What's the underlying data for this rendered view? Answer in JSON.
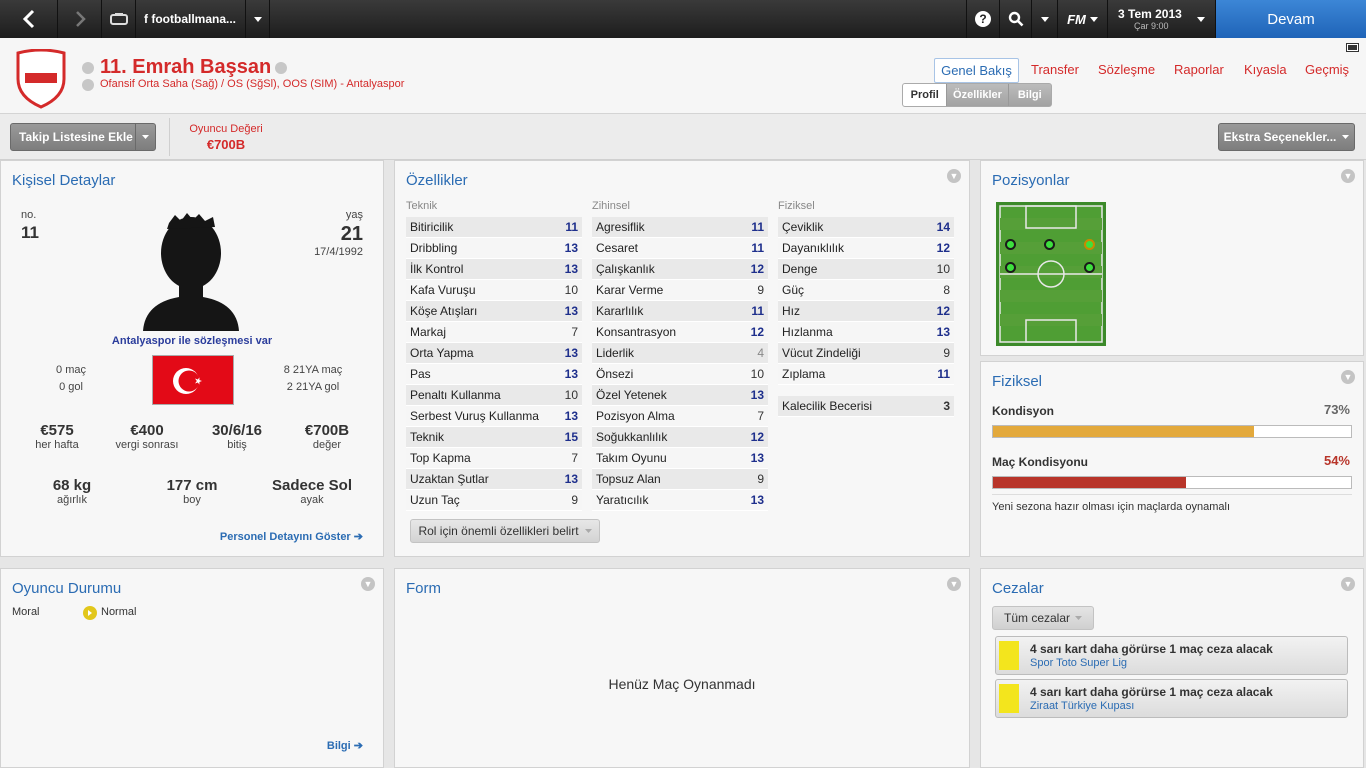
{
  "topbar": {
    "search_text": "f footballmana...",
    "fm_label": "FM",
    "date": "3 Tem 2013",
    "day_time": "Çar 9:00",
    "continue_label": "Devam"
  },
  "player": {
    "name": "11. Emrah Başsan",
    "positions": "Ofansif Orta Saha (Sağ) / OS (SğSl), OOS (SIM) - Antalyaspor"
  },
  "tabs": {
    "genel": "Genel Bakış",
    "transfer": "Transfer",
    "sozlesme": "Sözleşme",
    "raporlar": "Raporlar",
    "kiyasla": "Kıyasla",
    "gecmis": "Geçmiş",
    "sub_profil": "Profil",
    "sub_ozellikler": "Özellikler",
    "sub_bilgi": "Bilgi"
  },
  "actions": {
    "shortlist": "Takip Listesine Ekle",
    "value_label": "Oyuncu Değeri",
    "value": "€700B",
    "extra": "Ekstra Seçenekler..."
  },
  "personal": {
    "title": "Kişisel Detaylar",
    "no_label": "no.",
    "no": "11",
    "age_label": "yaş",
    "age": "21",
    "dob": "17/4/1992",
    "contract": "Antalyaspor ile sözleşmesi var",
    "apps": "0 maç",
    "goals": "0 gol",
    "u21_apps": "8 21YA maç",
    "u21_goals": "2 21YA gol",
    "wage": "€575",
    "wage_label": "her hafta",
    "after_tax": "€400",
    "after_tax_label": "vergi sonrası",
    "expires": "30/6/16",
    "expires_label": "bitiş",
    "value": "€700B",
    "value_label": "değer",
    "weight": "68 kg",
    "weight_label": "ağırlık",
    "height": "177 cm",
    "height_label": "boy",
    "foot": "Sadece Sol",
    "foot_label": "ayak",
    "link": "Personel Detayını Göster"
  },
  "attributes": {
    "title": "Özellikler",
    "technical_title": "Teknik",
    "mental_title": "Zihinsel",
    "physical_title": "Fiziksel",
    "technical": [
      {
        "n": "Bitiricilik",
        "v": "11"
      },
      {
        "n": "Dribbling",
        "v": "13"
      },
      {
        "n": "İlk Kontrol",
        "v": "13"
      },
      {
        "n": "Kafa Vuruşu",
        "v": "10"
      },
      {
        "n": "Köşe Atışları",
        "v": "13"
      },
      {
        "n": "Markaj",
        "v": "7"
      },
      {
        "n": "Orta Yapma",
        "v": "13"
      },
      {
        "n": "Pas",
        "v": "13"
      },
      {
        "n": "Penaltı Kullanma",
        "v": "10"
      },
      {
        "n": "Serbest Vuruş Kullanma",
        "v": "13"
      },
      {
        "n": "Teknik",
        "v": "15"
      },
      {
        "n": "Top Kapma",
        "v": "7"
      },
      {
        "n": "Uzaktan Şutlar",
        "v": "13"
      },
      {
        "n": "Uzun Taç",
        "v": "9"
      }
    ],
    "mental": [
      {
        "n": "Agresiflik",
        "v": "11"
      },
      {
        "n": "Cesaret",
        "v": "11"
      },
      {
        "n": "Çalışkanlık",
        "v": "12"
      },
      {
        "n": "Karar Verme",
        "v": "9"
      },
      {
        "n": "Kararlılık",
        "v": "11"
      },
      {
        "n": "Konsantrasyon",
        "v": "12"
      },
      {
        "n": "Liderlik",
        "v": "4"
      },
      {
        "n": "Önsezi",
        "v": "10"
      },
      {
        "n": "Özel Yetenek",
        "v": "13"
      },
      {
        "n": "Pozisyon Alma",
        "v": "7"
      },
      {
        "n": "Soğukkanlılık",
        "v": "12"
      },
      {
        "n": "Takım Oyunu",
        "v": "13"
      },
      {
        "n": "Topsuz Alan",
        "v": "9"
      },
      {
        "n": "Yaratıcılık",
        "v": "13"
      }
    ],
    "physical": [
      {
        "n": "Çeviklik",
        "v": "14"
      },
      {
        "n": "Dayanıklılık",
        "v": "12"
      },
      {
        "n": "Denge",
        "v": "10"
      },
      {
        "n": "Güç",
        "v": "8"
      },
      {
        "n": "Hız",
        "v": "12"
      },
      {
        "n": "Hızlanma",
        "v": "13"
      },
      {
        "n": "Vücut Zindeliği",
        "v": "9"
      },
      {
        "n": "Zıplama",
        "v": "11"
      }
    ],
    "goalkeeping": {
      "n": "Kalecilik Becerisi",
      "v": "3"
    },
    "role_button": "Rol için önemli özellikleri belirt"
  },
  "positions": {
    "title": "Pozisyonlar"
  },
  "physical": {
    "title": "Fiziksel",
    "condition_label": "Kondisyon",
    "condition": "73%",
    "condition_value": 0.73,
    "match_label": "Maç Kondisyonu",
    "match": "54%",
    "match_value": 0.54,
    "note": "Yeni sezona hazır olması için maçlarda oynamalı",
    "condition_color": "#e3a93c",
    "match_color": "#b8352a"
  },
  "status": {
    "title": "Oyuncu Durumu",
    "morale_label": "Moral",
    "morale": "Normal",
    "link": "Bilgi"
  },
  "form": {
    "title": "Form",
    "empty": "Henüz Maç Oynanmadı"
  },
  "bans": {
    "title": "Cezalar",
    "filter": "Tüm cezalar",
    "items": [
      {
        "text": "4 sarı kart daha görürse 1 maç ceza alacak",
        "comp": "Spor Toto Super Lig"
      },
      {
        "text": "4 sarı kart daha görürse 1 maç ceza alacak",
        "comp": "Ziraat Türkiye Kupası"
      }
    ]
  },
  "colors": {
    "accent": "#2b6cb3",
    "red": "#d42a2a",
    "continue": "#2a74c9",
    "value_num": "#1e2f8c"
  }
}
